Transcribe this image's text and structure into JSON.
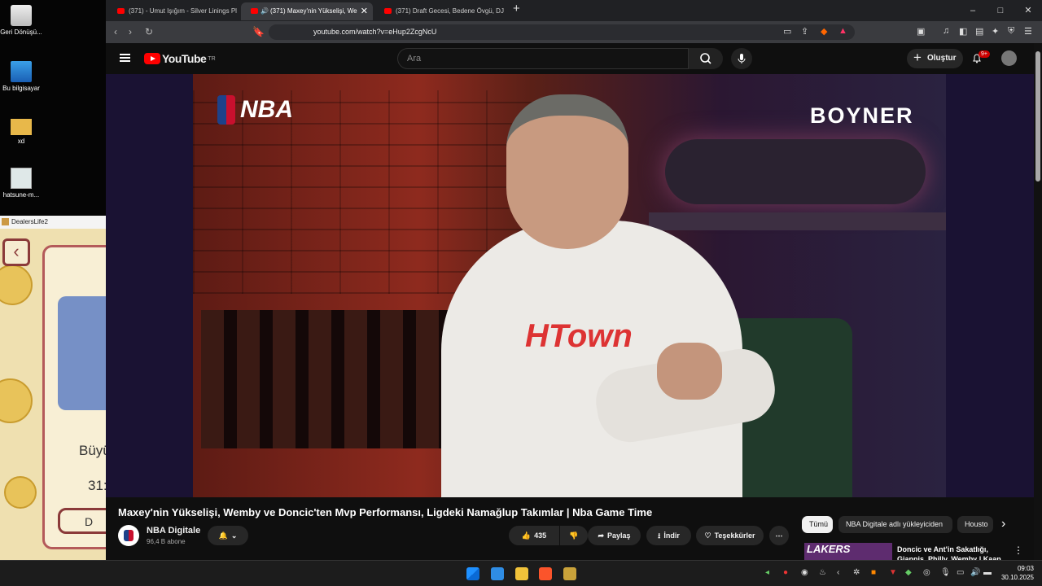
{
  "desktop": {
    "icons": [
      {
        "label": "Geri Dönüşü...",
        "icon": "recycle-bin-icon"
      },
      {
        "label": "Bu bilgisayar",
        "icon": "computer-icon"
      },
      {
        "label": "xd",
        "icon": "folder-icon"
      },
      {
        "label": "hatsune-m...",
        "icon": "image-file-icon"
      }
    ],
    "background_window": {
      "title": "DealersLife2",
      "visible_texts": [
        "Büyü",
        "31:",
        "D"
      ]
    }
  },
  "browser": {
    "tabs": [
      {
        "label": "(371) - Umut Işığım - Silver Linings Pl",
        "active": false
      },
      {
        "label": "(371) Maxey'nin Yükselişi, We",
        "active": true,
        "audio": true
      },
      {
        "label": "(371) Draft Gecesi, Bedene Övgü, DJ",
        "active": false
      }
    ],
    "new_tab": "+",
    "window_controls": [
      "–",
      "□",
      "✕"
    ],
    "url": "youtube.com/watch?v=eHup2ZcgNcU",
    "shield_count": "",
    "colors": {
      "tabbar": "#202124",
      "toolbar": "#3a3b3f",
      "accent": "#ff0000"
    }
  },
  "youtube": {
    "logo_text": "YouTube",
    "region": "TR",
    "search_placeholder": "Ara",
    "create_label": "Oluştur",
    "notifications_badge": "9+",
    "video": {
      "overlay_left": "NBA",
      "overlay_right": "BOYNER",
      "shirt_text": "HTown"
    },
    "title": "Maxey'nin Yükselişi, Wemby ve Doncic'ten Mvp Performansı, Ligdeki Namağlup Takımlar | Nba Game Time",
    "channel": {
      "name": "NBA Digitale",
      "subscribers": "96,4 B abone"
    },
    "actions": {
      "likes": "435",
      "share": "Paylaş",
      "download": "İndir",
      "thanks": "Teşekkürler",
      "more": "⋯"
    },
    "chips": [
      "Tümü",
      "NBA Digitale adlı yükleyiciden",
      "Housto"
    ],
    "recommendation": {
      "thumb_text": "LAKERS",
      "title": "Doncic ve Ant'in Sakatlığı, Giannis, Philly, Wemby | Kaan"
    }
  },
  "taskbar": {
    "time": "09:03",
    "date": "30.10.2025"
  }
}
